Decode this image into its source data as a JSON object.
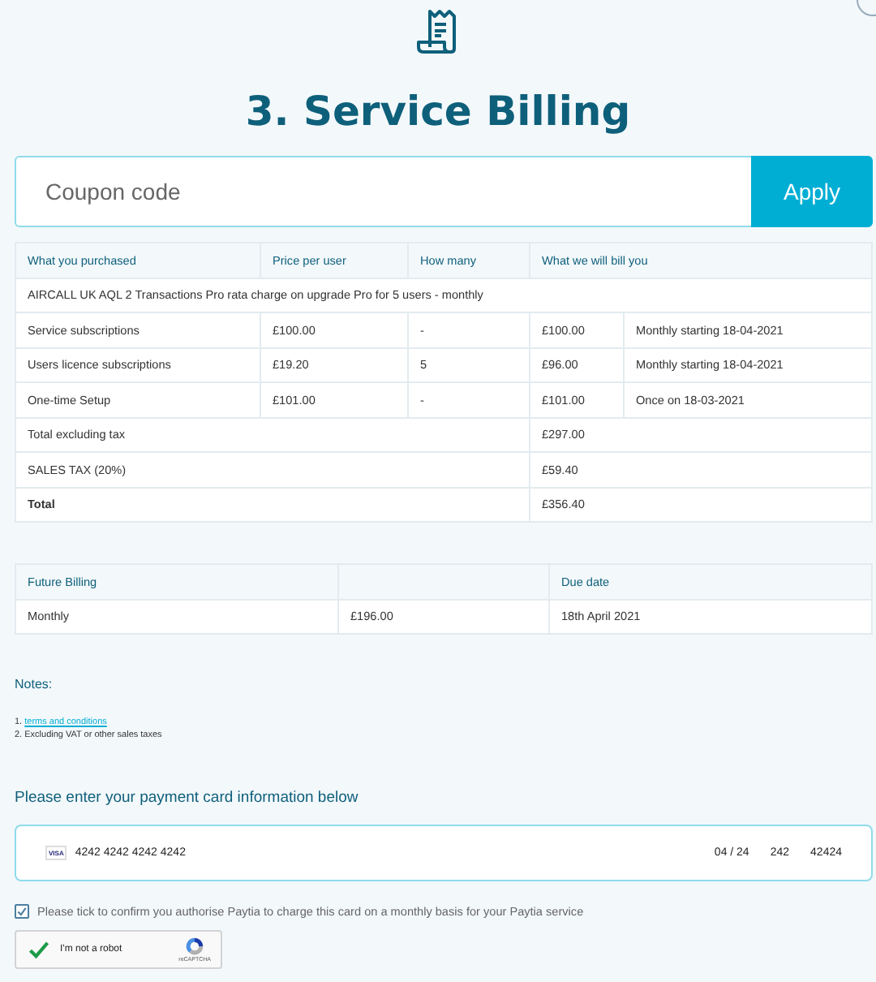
{
  "title": "3. Service Billing",
  "coupon": {
    "placeholder": "Coupon code",
    "button": "Apply"
  },
  "purchase_table": {
    "columns": [
      "What you purchased",
      "Price per user",
      "How many",
      "What we will bill you"
    ],
    "description": "AIRCALL UK AQL 2 Transactions Pro rata charge on upgrade Pro for 5 users - monthly",
    "items": [
      {
        "name": "Service subscriptions",
        "price": "£100.00",
        "quantity": "-",
        "amount": "£100.00",
        "schedule": "Monthly starting 18-04-2021"
      },
      {
        "name": "Users licence subscriptions",
        "price": "£19.20",
        "quantity": "5",
        "amount": "£96.00",
        "schedule": "Monthly starting 18-04-2021"
      },
      {
        "name": "One-time Setup",
        "price": "£101.00",
        "quantity": "-",
        "amount": "£101.00",
        "schedule": "Once on 18-03-2021"
      }
    ],
    "totals": [
      {
        "label": "Total excluding tax",
        "amount": "£297.00",
        "kind": "plain"
      },
      {
        "label": "SALES TAX (20%)",
        "amount": "£59.40",
        "kind": "plain"
      },
      {
        "label": "Total",
        "amount": "£356.40",
        "kind": "total"
      }
    ]
  },
  "future_table": {
    "column_1": "Future Billing",
    "column_3": "Due date",
    "rows": [
      {
        "period": "Monthly",
        "amount": "£196.00",
        "due": "18th April 2021"
      }
    ]
  },
  "notes": {
    "heading": "Notes:",
    "link_prefix": "1.",
    "link": "terms and conditions",
    "items": [
      "2. Excluding VAT or other sales taxes"
    ]
  },
  "payment": {
    "heading": "Please enter your payment card information below",
    "brand": "VISA",
    "number": "4242 4242 4242 4242",
    "expiry": "04 / 24",
    "cvc": "242",
    "postcode": "42424"
  },
  "authorise": {
    "label": "Please tick to confirm you authorise Paytia to charge this card on a monthly basis for your Paytia service",
    "checked": true
  },
  "captcha": {
    "label": "I'm not a robot",
    "checked": true,
    "brand": "reCAPTCHA"
  }
}
